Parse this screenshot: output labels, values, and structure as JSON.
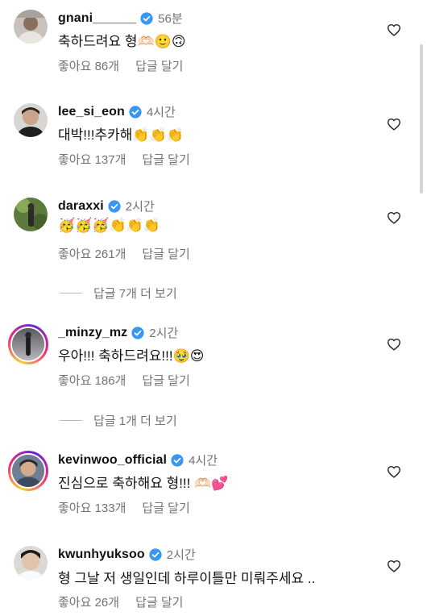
{
  "comments": [
    {
      "username": "gnani______",
      "time": "56분",
      "text": "축하드려요 형🫶🏻🙂🙃",
      "likes": "좋아요 86개",
      "reply": "답글 달기"
    },
    {
      "username": "lee_si_eon",
      "time": "4시간",
      "text": "대박!!!추카해👏👏👏",
      "likes": "좋아요 137개",
      "reply": "답글 달기"
    },
    {
      "username": "daraxxi",
      "time": "2시간",
      "text": "🥳🥳🥳👏👏👏",
      "likes": "좋아요 261개",
      "reply": "답글 달기",
      "view_replies": "답글 7개 더 보기"
    },
    {
      "username": "_minzy_mz",
      "time": "2시간",
      "text": "우아!!! 축하드려요!!!🥹😍",
      "likes": "좋아요 186개",
      "reply": "답글 달기",
      "view_replies": "답글 1개 더 보기"
    },
    {
      "username": "kevinwoo_official",
      "time": "4시간",
      "text": "진심으로 축하해요 형!!! 🫶🏻💕",
      "likes": "좋아요 133개",
      "reply": "답글 달기"
    },
    {
      "username": "kwunhyuksoo",
      "time": "2시간",
      "text": "형 그날 저 생일인데 하루이틀만 미뤄주세요 ..",
      "likes": "좋아요 26개",
      "reply": "답글 달기"
    }
  ],
  "colors": {
    "verified": "#3897f0",
    "muted": "#737373",
    "story_ring": [
      "#f9ce34",
      "#ee2a7b",
      "#6228d7"
    ]
  },
  "icons": {
    "verified": "verified-badge-icon",
    "like": "heart-outline-icon"
  }
}
